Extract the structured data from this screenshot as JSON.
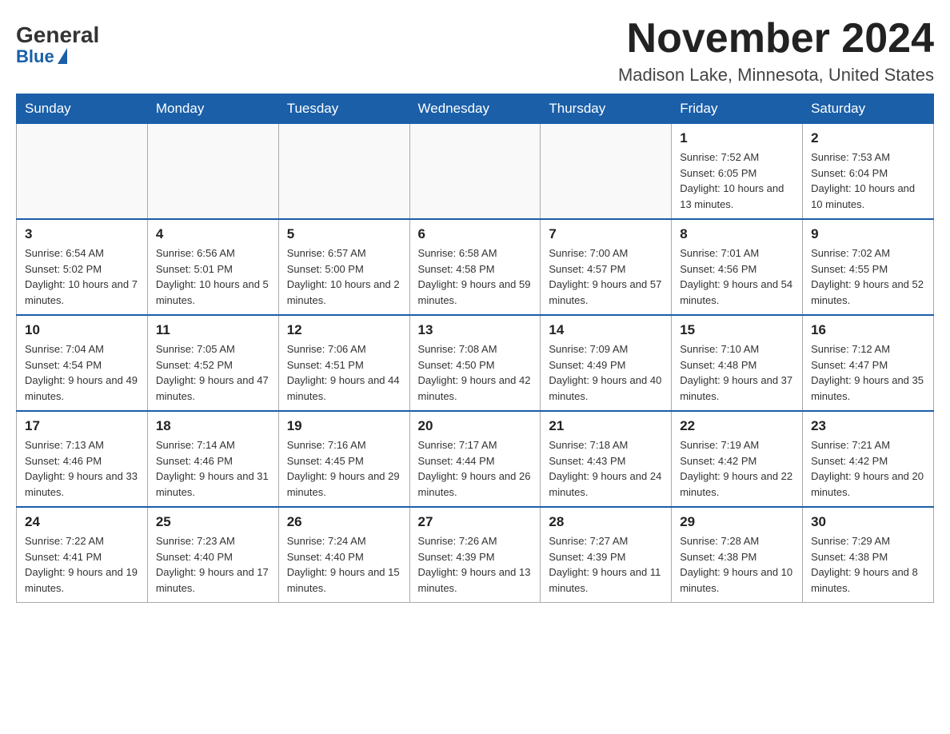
{
  "header": {
    "logo_general": "General",
    "logo_blue": "Blue",
    "month_title": "November 2024",
    "location": "Madison Lake, Minnesota, United States"
  },
  "days_of_week": [
    "Sunday",
    "Monday",
    "Tuesday",
    "Wednesday",
    "Thursday",
    "Friday",
    "Saturday"
  ],
  "weeks": [
    [
      {
        "day": "",
        "sunrise": "",
        "sunset": "",
        "daylight": "",
        "empty": true
      },
      {
        "day": "",
        "sunrise": "",
        "sunset": "",
        "daylight": "",
        "empty": true
      },
      {
        "day": "",
        "sunrise": "",
        "sunset": "",
        "daylight": "",
        "empty": true
      },
      {
        "day": "",
        "sunrise": "",
        "sunset": "",
        "daylight": "",
        "empty": true
      },
      {
        "day": "",
        "sunrise": "",
        "sunset": "",
        "daylight": "",
        "empty": true
      },
      {
        "day": "1",
        "sunrise": "Sunrise: 7:52 AM",
        "sunset": "Sunset: 6:05 PM",
        "daylight": "Daylight: 10 hours and 13 minutes.",
        "empty": false
      },
      {
        "day": "2",
        "sunrise": "Sunrise: 7:53 AM",
        "sunset": "Sunset: 6:04 PM",
        "daylight": "Daylight: 10 hours and 10 minutes.",
        "empty": false
      }
    ],
    [
      {
        "day": "3",
        "sunrise": "Sunrise: 6:54 AM",
        "sunset": "Sunset: 5:02 PM",
        "daylight": "Daylight: 10 hours and 7 minutes.",
        "empty": false
      },
      {
        "day": "4",
        "sunrise": "Sunrise: 6:56 AM",
        "sunset": "Sunset: 5:01 PM",
        "daylight": "Daylight: 10 hours and 5 minutes.",
        "empty": false
      },
      {
        "day": "5",
        "sunrise": "Sunrise: 6:57 AM",
        "sunset": "Sunset: 5:00 PM",
        "daylight": "Daylight: 10 hours and 2 minutes.",
        "empty": false
      },
      {
        "day": "6",
        "sunrise": "Sunrise: 6:58 AM",
        "sunset": "Sunset: 4:58 PM",
        "daylight": "Daylight: 9 hours and 59 minutes.",
        "empty": false
      },
      {
        "day": "7",
        "sunrise": "Sunrise: 7:00 AM",
        "sunset": "Sunset: 4:57 PM",
        "daylight": "Daylight: 9 hours and 57 minutes.",
        "empty": false
      },
      {
        "day": "8",
        "sunrise": "Sunrise: 7:01 AM",
        "sunset": "Sunset: 4:56 PM",
        "daylight": "Daylight: 9 hours and 54 minutes.",
        "empty": false
      },
      {
        "day": "9",
        "sunrise": "Sunrise: 7:02 AM",
        "sunset": "Sunset: 4:55 PM",
        "daylight": "Daylight: 9 hours and 52 minutes.",
        "empty": false
      }
    ],
    [
      {
        "day": "10",
        "sunrise": "Sunrise: 7:04 AM",
        "sunset": "Sunset: 4:54 PM",
        "daylight": "Daylight: 9 hours and 49 minutes.",
        "empty": false
      },
      {
        "day": "11",
        "sunrise": "Sunrise: 7:05 AM",
        "sunset": "Sunset: 4:52 PM",
        "daylight": "Daylight: 9 hours and 47 minutes.",
        "empty": false
      },
      {
        "day": "12",
        "sunrise": "Sunrise: 7:06 AM",
        "sunset": "Sunset: 4:51 PM",
        "daylight": "Daylight: 9 hours and 44 minutes.",
        "empty": false
      },
      {
        "day": "13",
        "sunrise": "Sunrise: 7:08 AM",
        "sunset": "Sunset: 4:50 PM",
        "daylight": "Daylight: 9 hours and 42 minutes.",
        "empty": false
      },
      {
        "day": "14",
        "sunrise": "Sunrise: 7:09 AM",
        "sunset": "Sunset: 4:49 PM",
        "daylight": "Daylight: 9 hours and 40 minutes.",
        "empty": false
      },
      {
        "day": "15",
        "sunrise": "Sunrise: 7:10 AM",
        "sunset": "Sunset: 4:48 PM",
        "daylight": "Daylight: 9 hours and 37 minutes.",
        "empty": false
      },
      {
        "day": "16",
        "sunrise": "Sunrise: 7:12 AM",
        "sunset": "Sunset: 4:47 PM",
        "daylight": "Daylight: 9 hours and 35 minutes.",
        "empty": false
      }
    ],
    [
      {
        "day": "17",
        "sunrise": "Sunrise: 7:13 AM",
        "sunset": "Sunset: 4:46 PM",
        "daylight": "Daylight: 9 hours and 33 minutes.",
        "empty": false
      },
      {
        "day": "18",
        "sunrise": "Sunrise: 7:14 AM",
        "sunset": "Sunset: 4:46 PM",
        "daylight": "Daylight: 9 hours and 31 minutes.",
        "empty": false
      },
      {
        "day": "19",
        "sunrise": "Sunrise: 7:16 AM",
        "sunset": "Sunset: 4:45 PM",
        "daylight": "Daylight: 9 hours and 29 minutes.",
        "empty": false
      },
      {
        "day": "20",
        "sunrise": "Sunrise: 7:17 AM",
        "sunset": "Sunset: 4:44 PM",
        "daylight": "Daylight: 9 hours and 26 minutes.",
        "empty": false
      },
      {
        "day": "21",
        "sunrise": "Sunrise: 7:18 AM",
        "sunset": "Sunset: 4:43 PM",
        "daylight": "Daylight: 9 hours and 24 minutes.",
        "empty": false
      },
      {
        "day": "22",
        "sunrise": "Sunrise: 7:19 AM",
        "sunset": "Sunset: 4:42 PM",
        "daylight": "Daylight: 9 hours and 22 minutes.",
        "empty": false
      },
      {
        "day": "23",
        "sunrise": "Sunrise: 7:21 AM",
        "sunset": "Sunset: 4:42 PM",
        "daylight": "Daylight: 9 hours and 20 minutes.",
        "empty": false
      }
    ],
    [
      {
        "day": "24",
        "sunrise": "Sunrise: 7:22 AM",
        "sunset": "Sunset: 4:41 PM",
        "daylight": "Daylight: 9 hours and 19 minutes.",
        "empty": false
      },
      {
        "day": "25",
        "sunrise": "Sunrise: 7:23 AM",
        "sunset": "Sunset: 4:40 PM",
        "daylight": "Daylight: 9 hours and 17 minutes.",
        "empty": false
      },
      {
        "day": "26",
        "sunrise": "Sunrise: 7:24 AM",
        "sunset": "Sunset: 4:40 PM",
        "daylight": "Daylight: 9 hours and 15 minutes.",
        "empty": false
      },
      {
        "day": "27",
        "sunrise": "Sunrise: 7:26 AM",
        "sunset": "Sunset: 4:39 PM",
        "daylight": "Daylight: 9 hours and 13 minutes.",
        "empty": false
      },
      {
        "day": "28",
        "sunrise": "Sunrise: 7:27 AM",
        "sunset": "Sunset: 4:39 PM",
        "daylight": "Daylight: 9 hours and 11 minutes.",
        "empty": false
      },
      {
        "day": "29",
        "sunrise": "Sunrise: 7:28 AM",
        "sunset": "Sunset: 4:38 PM",
        "daylight": "Daylight: 9 hours and 10 minutes.",
        "empty": false
      },
      {
        "day": "30",
        "sunrise": "Sunrise: 7:29 AM",
        "sunset": "Sunset: 4:38 PM",
        "daylight": "Daylight: 9 hours and 8 minutes.",
        "empty": false
      }
    ]
  ]
}
